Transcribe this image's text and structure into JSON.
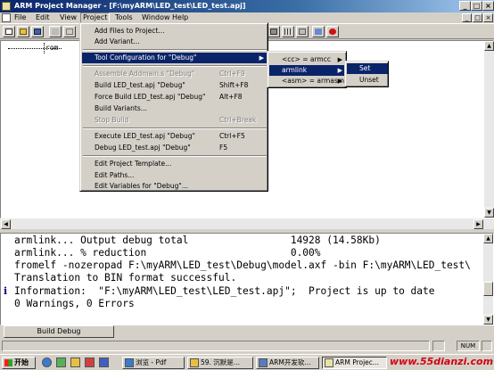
{
  "window": {
    "title": "ARM Project Manager - [F:\\myARM\\LED_test\\LED_test.apj]",
    "minimize_glyph": "_",
    "maximize_glyph": "□",
    "close_glyph": "×"
  },
  "menubar": {
    "items": [
      "File",
      "Edit",
      "View",
      "Project",
      "Tools",
      "Window",
      "Help"
    ],
    "active": "Project"
  },
  "tree": {
    "root_label": "rom"
  },
  "project_menu": {
    "items": [
      {
        "label": "Add Files to Project...",
        "shortcut": "",
        "enabled": true
      },
      {
        "label": "Add Variant...",
        "shortcut": "",
        "enabled": true
      },
      {
        "label": "Tool Configuration for \"Debug\"",
        "shortcut": "",
        "enabled": true,
        "submenu": true,
        "selected": true
      },
      {
        "label": "Assemble Addmain.s \"Debug\"",
        "shortcut": "Ctrl+F9",
        "enabled": false
      },
      {
        "label": "Build LED_test.apj \"Debug\"",
        "shortcut": "Shift+F8",
        "enabled": true
      },
      {
        "label": "Force Build LED_test.apj \"Debug\"",
        "shortcut": "Alt+F8",
        "enabled": true
      },
      {
        "label": "Build Variants...",
        "shortcut": "",
        "enabled": true
      },
      {
        "label": "Stop Build",
        "shortcut": "Ctrl+Break",
        "enabled": false
      },
      {
        "label": "Execute LED_test.apj \"Debug\"",
        "shortcut": "Ctrl+F5",
        "enabled": true
      },
      {
        "label": "Debug LED_test.apj \"Debug\"",
        "shortcut": "F5",
        "enabled": true
      },
      {
        "label": "Edit Project Template...",
        "shortcut": "",
        "enabled": true
      },
      {
        "label": "Edit Paths...",
        "shortcut": "",
        "enabled": true
      },
      {
        "label": "Edit Variables for \"Debug\"...",
        "shortcut": "",
        "enabled": true
      }
    ]
  },
  "tool_config_submenu": {
    "items": [
      {
        "label": "<cc> = armcc",
        "selected": false
      },
      {
        "label": "armlink",
        "selected": true
      },
      {
        "label": "<asm> = armasm",
        "selected": false
      }
    ]
  },
  "armlink_submenu": {
    "items": [
      {
        "label": "Set",
        "selected": true
      },
      {
        "label": "Unset",
        "selected": false
      }
    ]
  },
  "output": {
    "lines": [
      "armlink... Output debug total                 14928 (14.58Kb)",
      "armlink... % reduction                        0.00%",
      "fromelf -nozeropad F:\\myARM\\LED_test\\Debug\\model.axf -bin F:\\myARM\\LED_test\\",
      "Translation to BIN format successful.",
      "Information:  \"F:\\myARM\\LED_test\\LED_test.apj\";  Project is up to date",
      "0 Warnings, 0 Errors"
    ],
    "info_line_index": 4,
    "info_glyph": "i"
  },
  "tabs": {
    "build": "Build Debug"
  },
  "statusbar": {
    "num": "NUM"
  },
  "taskbar": {
    "start": "开始",
    "items": [
      {
        "label": "浏览 - Pdf",
        "active": false
      },
      {
        "label": "59. 沉默是...",
        "active": false
      },
      {
        "label": "ARM开发软...",
        "active": false
      },
      {
        "label": "ARM Projec...",
        "active": true
      }
    ],
    "watermark": "www.55dianzi.com"
  },
  "colors": {
    "menu_highlight": "#0a246a",
    "title_gradient_start": "#0a246a",
    "watermark": "#d4000f"
  }
}
